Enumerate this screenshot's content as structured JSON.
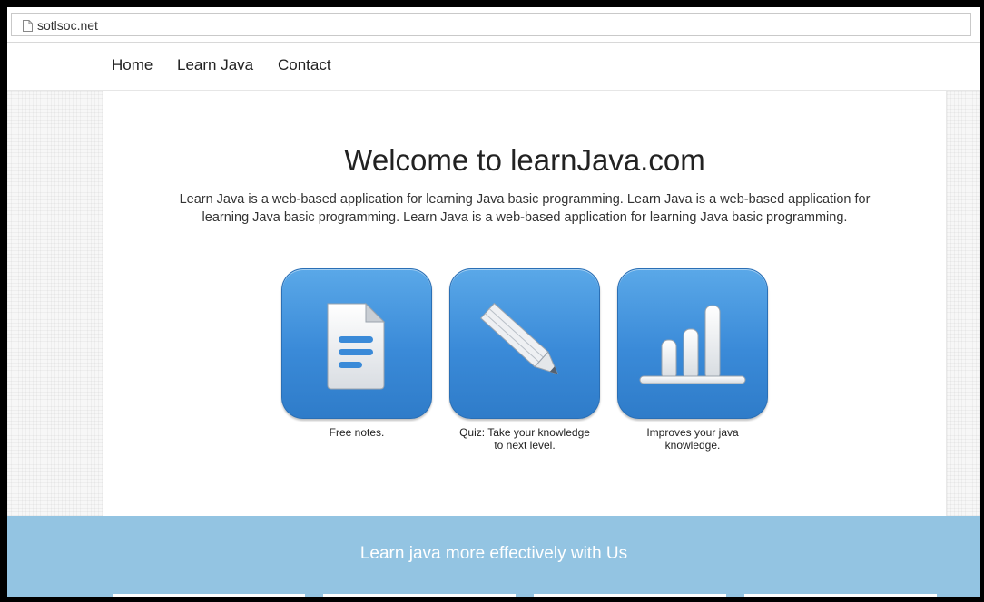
{
  "browser": {
    "url": "sotlsoc.net",
    "page_icon": "page-icon"
  },
  "nav": {
    "items": [
      {
        "label": "Home"
      },
      {
        "label": "Learn Java"
      },
      {
        "label": "Contact"
      }
    ]
  },
  "hero": {
    "title": "Welcome to learnJava.com",
    "description": "Learn Java is a web-based application for learning Java basic programming. Learn Java is a web-based application for learning Java basic programming. Learn Java is a web-based application for learning Java basic programming."
  },
  "features": [
    {
      "icon": "document-icon",
      "caption_line1": "Free notes.",
      "caption_line2": ""
    },
    {
      "icon": "pencil-icon",
      "caption_line1": "Quiz: Take your knowledge",
      "caption_line2": "to next level."
    },
    {
      "icon": "bar-chart-icon",
      "caption_line1": "Improves your java",
      "caption_line2": "knowledge."
    }
  ],
  "footer": {
    "title": "Learn java more effectively with Us"
  },
  "colors": {
    "tile_blue": "#3a8ad8",
    "footer_band": "#93c4e2"
  }
}
